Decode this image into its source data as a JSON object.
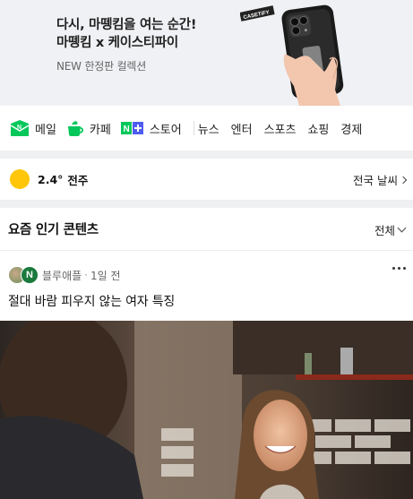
{
  "banner": {
    "line1": "다시, 마뗑킴을 여는 순간!",
    "line2": "마뗑킴 x 케이스티파이",
    "sub": "NEW 한정판 컬렉션",
    "brand_tag": "CASETiFY"
  },
  "services": [
    {
      "icon": "mail-icon",
      "label": "메일"
    },
    {
      "icon": "cafe-icon",
      "label": "카페"
    },
    {
      "icon": "store-icon",
      "label": "스토어"
    }
  ],
  "nav_links": [
    "뉴스",
    "엔터",
    "스포츠",
    "쇼핑",
    "경제"
  ],
  "weather": {
    "temp": "2.4°",
    "location": "전주",
    "link": "전국 날씨"
  },
  "popular": {
    "title": "요즘 인기 콘텐츠",
    "all_label": "전체",
    "post": {
      "author": "블루애플",
      "time": "1일 전",
      "title": "절대 바람 피우지 않는 여자 특징"
    }
  },
  "colors": {
    "brand_green": "#03c75a",
    "sun": "#ffc60a",
    "banner_bg": "#f0f1f4"
  }
}
